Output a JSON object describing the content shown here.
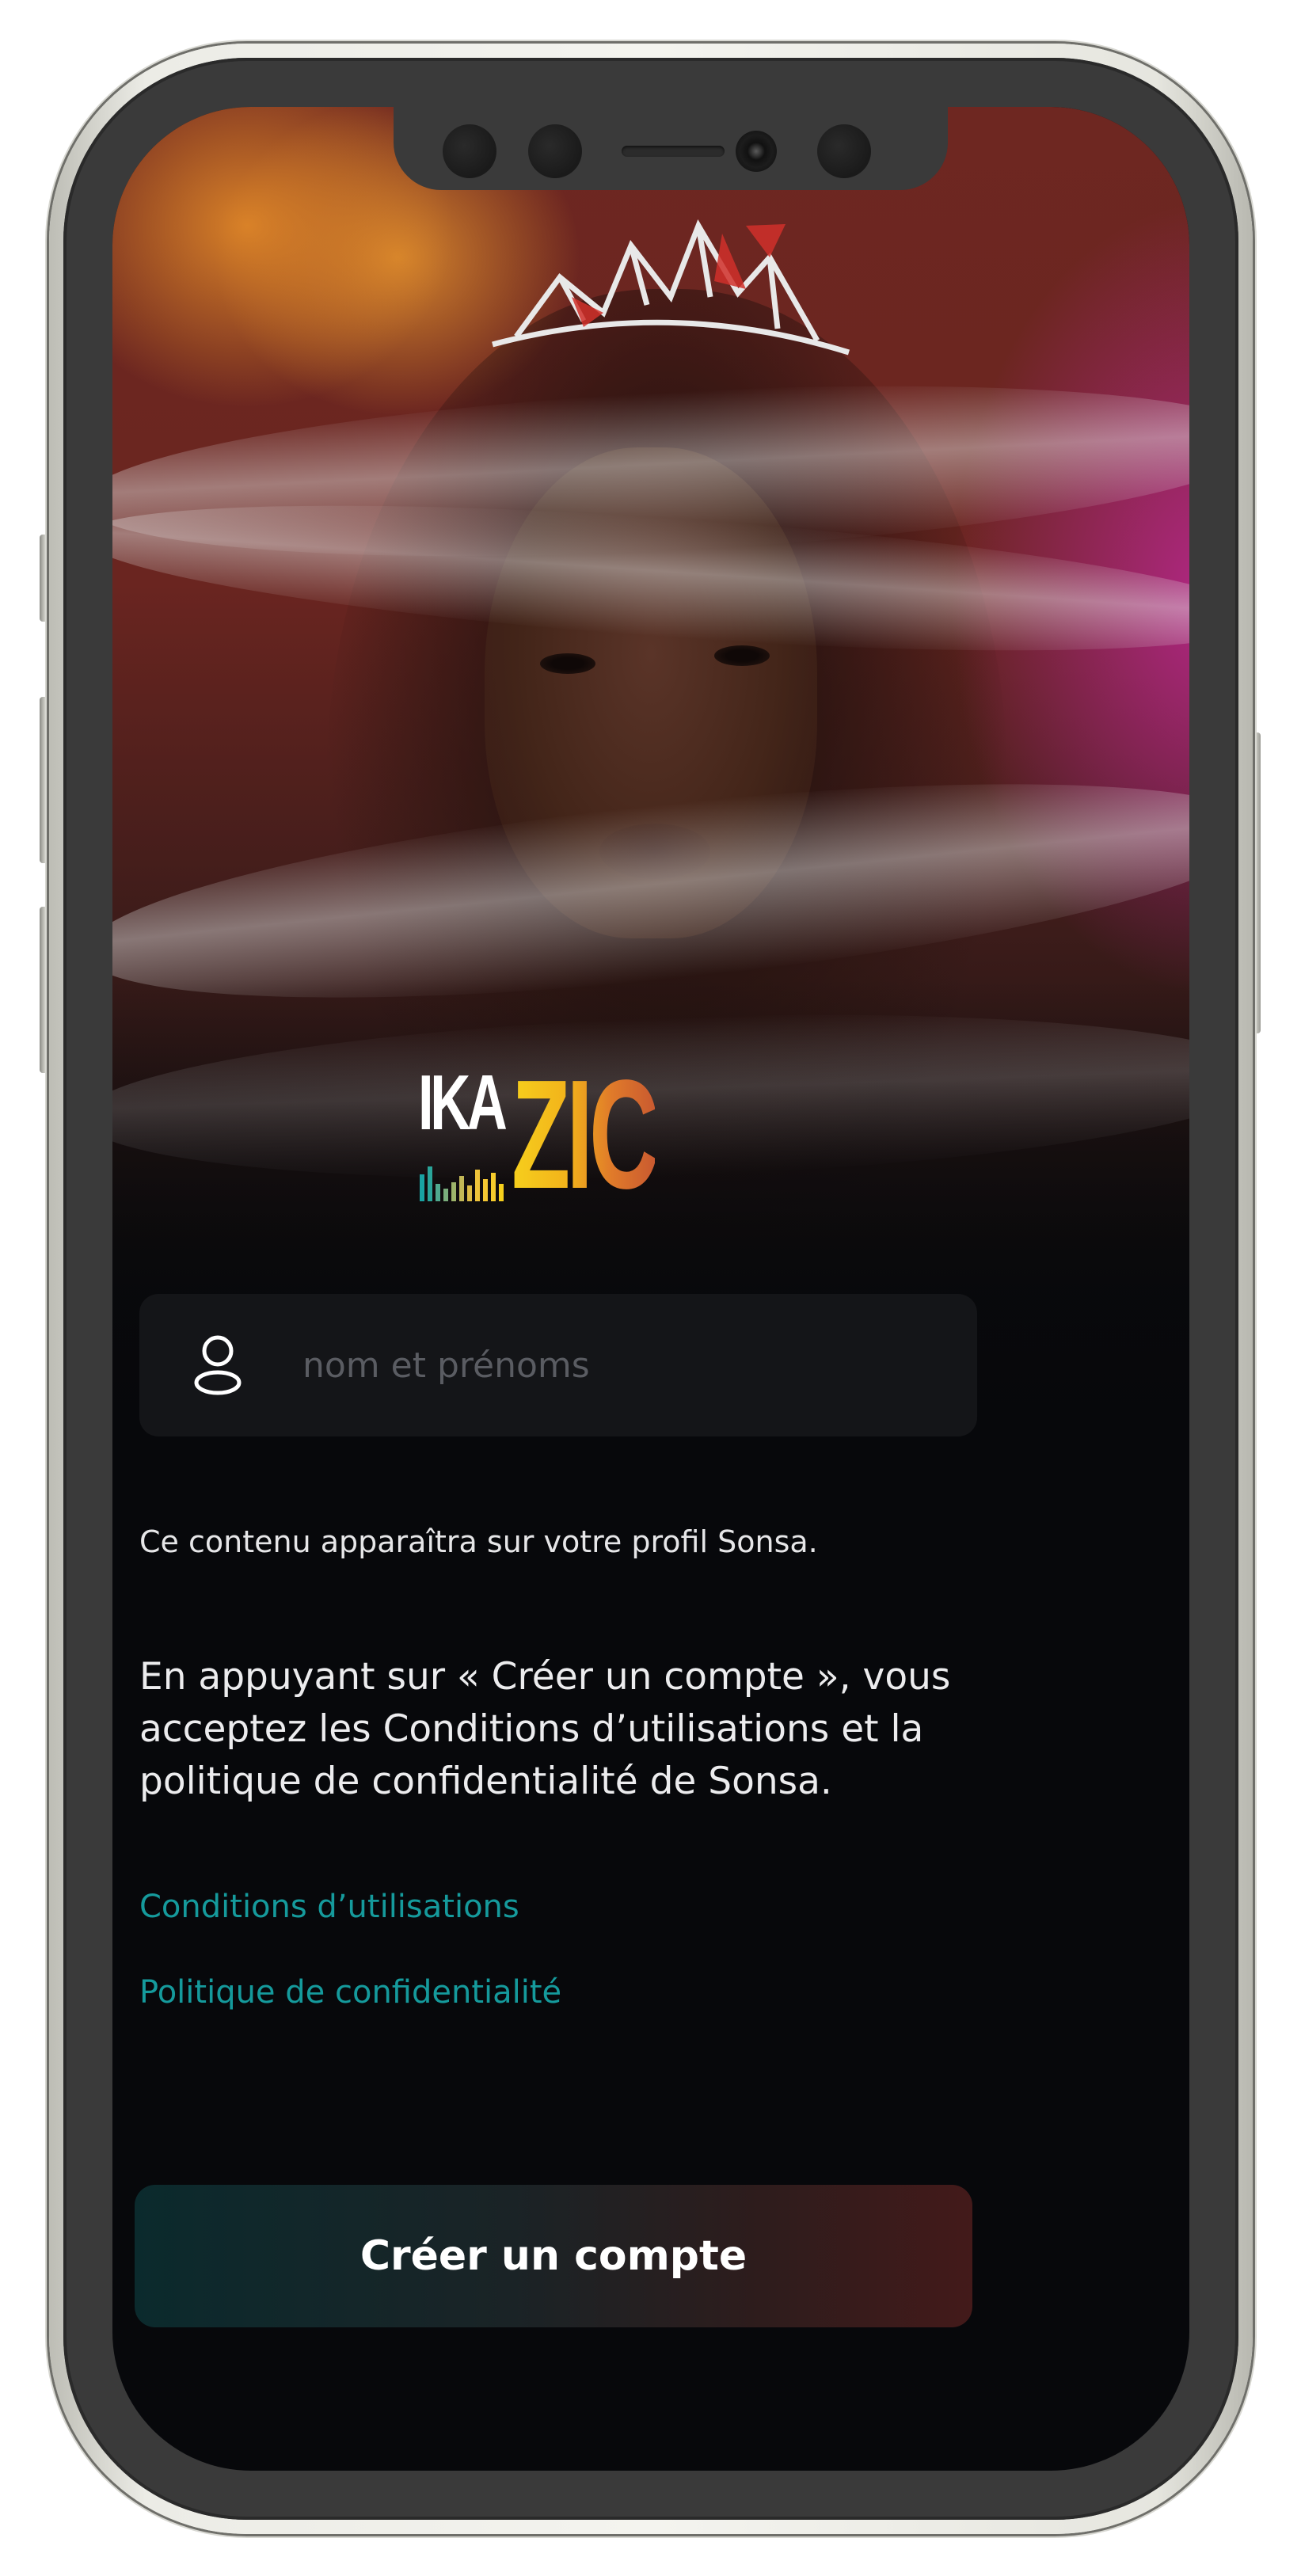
{
  "app": {
    "name": "IKAZIC",
    "logo": {
      "part1": "IKA",
      "part2": "ZIC"
    }
  },
  "form": {
    "name_field": {
      "placeholder": "nom et prénoms",
      "value": "",
      "icon": "user-icon"
    },
    "helper_text": "Ce contenu apparaîtra sur votre profil Sonsa."
  },
  "terms": {
    "text": "En appuyant sur « Créer un compte », vous acceptez les Conditions d’utilisations et la politique de confidentialité de Sonsa."
  },
  "links": {
    "conditions": "Conditions d’utilisations",
    "privacy": "Politique de confidentialité"
  },
  "actions": {
    "create_account": "Créer un compte"
  },
  "colors": {
    "background": "#07080b",
    "input_bg": "#141518",
    "link": "#159a9c",
    "logo_yellow": "#f6cf1c",
    "logo_orange": "#e07a2a",
    "button_left": "#0b2a2d",
    "button_right": "#431a1a"
  }
}
